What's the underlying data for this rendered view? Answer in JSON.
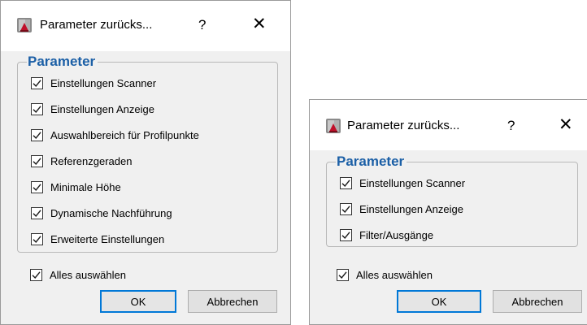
{
  "dialog1": {
    "title": "Parameter zurücks...",
    "help_label": "?",
    "close_label": "✕",
    "group_title": "Parameter",
    "options": [
      {
        "label": "Einstellungen Scanner",
        "checked": true
      },
      {
        "label": "Einstellungen Anzeige",
        "checked": true
      },
      {
        "label": "Auswahlbereich für Profilpunkte",
        "checked": true
      },
      {
        "label": "Referenzgeraden",
        "checked": true
      },
      {
        "label": "Minimale Höhe",
        "checked": true
      },
      {
        "label": "Dynamische Nachführung",
        "checked": true
      },
      {
        "label": "Erweiterte Einstellungen",
        "checked": true
      }
    ],
    "select_all_label": "Alles auswählen",
    "select_all_checked": true,
    "ok_label": "OK",
    "cancel_label": "Abbrechen"
  },
  "dialog2": {
    "title": "Parameter zurücks...",
    "help_label": "?",
    "close_label": "✕",
    "group_title": "Parameter",
    "options": [
      {
        "label": "Einstellungen Scanner",
        "checked": true
      },
      {
        "label": "Einstellungen Anzeige",
        "checked": true
      },
      {
        "label": "Filter/Ausgänge",
        "checked": true
      }
    ],
    "select_all_label": "Alles auswählen",
    "select_all_checked": true,
    "ok_label": "OK",
    "cancel_label": "Abbrechen"
  },
  "colors": {
    "group_title": "#1b5fa6",
    "default_button_border": "#0078d7",
    "dialog_background": "#f0f0f0"
  },
  "icons": {
    "app": "scanner-app-icon",
    "help": "help-icon",
    "close": "close-icon",
    "check": "checkmark-icon"
  }
}
